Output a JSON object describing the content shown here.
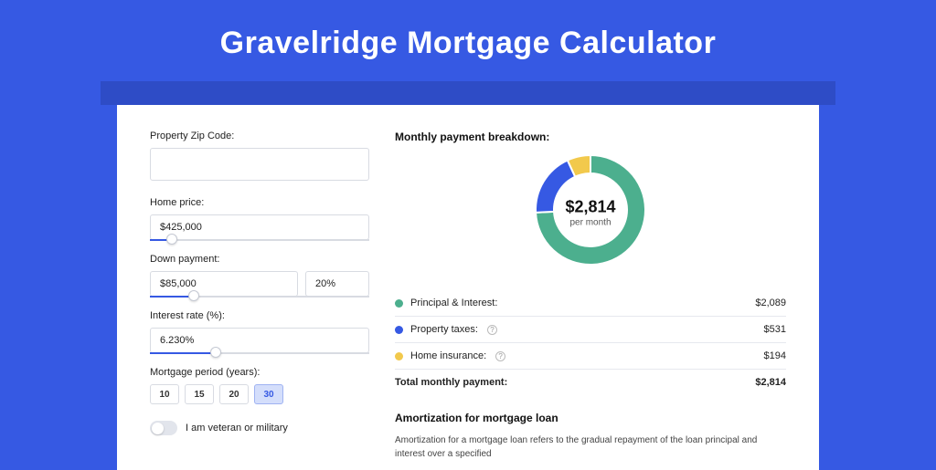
{
  "title": "Gravelridge Mortgage Calculator",
  "form": {
    "zip_label": "Property Zip Code:",
    "zip_value": "",
    "home_price_label": "Home price:",
    "home_price_value": "$425,000",
    "home_price_slider_pct": 10,
    "down_payment_label": "Down payment:",
    "down_payment_value": "$85,000",
    "down_payment_pct_value": "20%",
    "down_payment_slider_pct": 20,
    "interest_label": "Interest rate (%):",
    "interest_value": "6.230%",
    "interest_slider_pct": 30,
    "period_label": "Mortgage period (years):",
    "period_options": [
      "10",
      "15",
      "20",
      "30"
    ],
    "period_selected": "30",
    "veteran_label": "I am veteran or military"
  },
  "breakdown": {
    "title": "Monthly payment breakdown:",
    "center_amount": "$2,814",
    "center_sub": "per month",
    "items": [
      {
        "label": "Principal & Interest:",
        "amount": "$2,089",
        "color": "#4CAF8E",
        "help": false
      },
      {
        "label": "Property taxes:",
        "amount": "$531",
        "color": "#3659E3",
        "help": true
      },
      {
        "label": "Home insurance:",
        "amount": "$194",
        "color": "#F2C94C",
        "help": true
      }
    ],
    "total_label": "Total monthly payment:",
    "total_amount": "$2,814"
  },
  "chart_data": {
    "type": "pie",
    "title": "Monthly payment breakdown",
    "series": [
      {
        "name": "Principal & Interest",
        "value": 2089,
        "color": "#4CAF8E"
      },
      {
        "name": "Property taxes",
        "value": 531,
        "color": "#3659E3"
      },
      {
        "name": "Home insurance",
        "value": 194,
        "color": "#F2C94C"
      }
    ],
    "total": 2814,
    "center_label": "$2,814 per month"
  },
  "amortization": {
    "title": "Amortization for mortgage loan",
    "body": "Amortization for a mortgage loan refers to the gradual repayment of the loan principal and interest over a specified"
  }
}
